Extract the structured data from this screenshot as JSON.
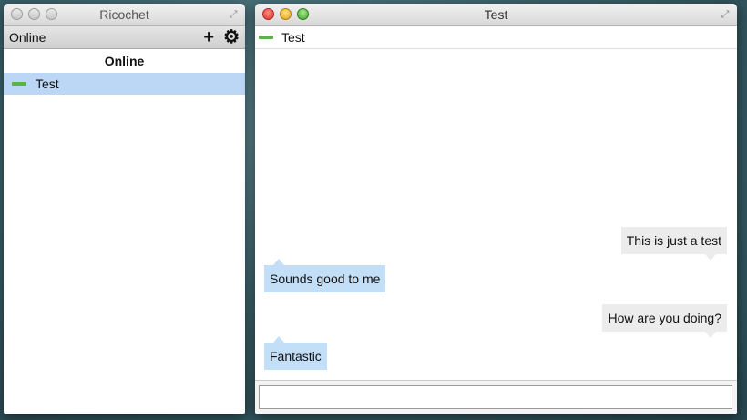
{
  "contact_window": {
    "title": "Ricochet",
    "status": "Online",
    "add_icon": "plus-icon",
    "settings_icon": "gear-icon",
    "section_header": "Online",
    "contacts": [
      {
        "name": "Test",
        "status_color": "#5cb24a"
      }
    ]
  },
  "chat_window": {
    "title": "Test",
    "contact_name": "Test",
    "messages": [
      {
        "text": "This is just a test",
        "direction": "sent"
      },
      {
        "text": "Sounds good to me",
        "direction": "received"
      },
      {
        "text": "How are you doing?",
        "direction": "sent"
      },
      {
        "text": "Fantastic",
        "direction": "received"
      }
    ],
    "input_value": "",
    "input_placeholder": ""
  },
  "colors": {
    "selected_row": "#bcd6f6",
    "received_bubble": "#c3def7",
    "sent_bubble": "#ececec",
    "online_status": "#5cb24a"
  }
}
